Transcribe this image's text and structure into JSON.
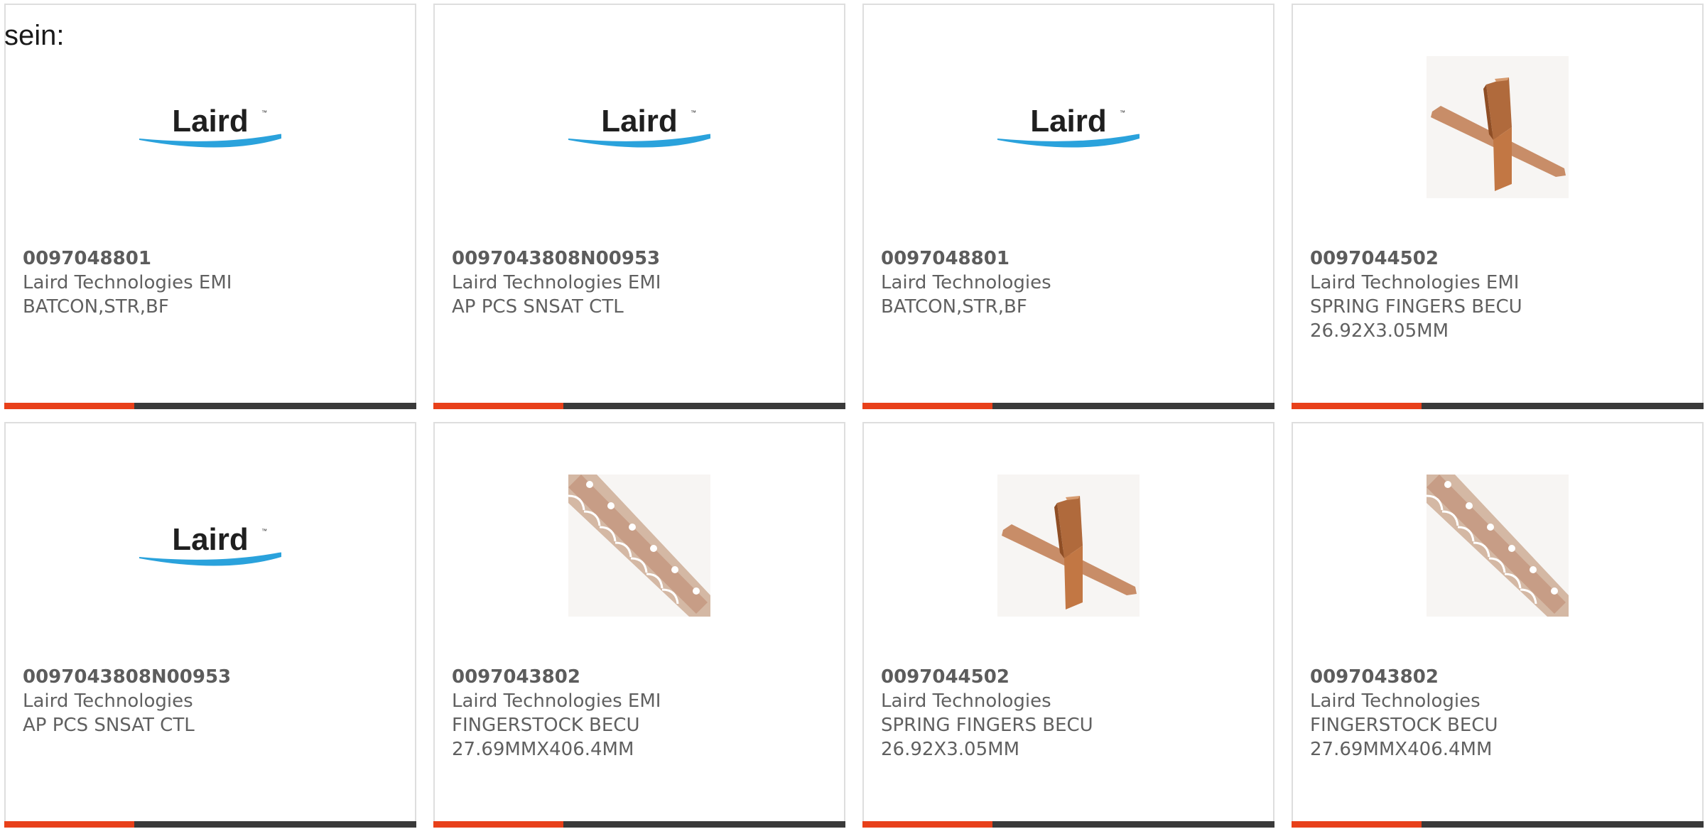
{
  "intro_text": "sein:",
  "colors": {
    "accent": "#e8401a",
    "bar_dark": "#3a3a3a",
    "text": "#606060",
    "border": "#dedede"
  },
  "products": [
    {
      "part_number": "0097048801",
      "manufacturer": "Laird Technologies EMI",
      "desc1": "BATCON,STR,BF",
      "desc2": "",
      "image": "laird-logo"
    },
    {
      "part_number": "0097043808N00953",
      "manufacturer": "Laird Technologies EMI",
      "desc1": "AP PCS SNSAT CTL",
      "desc2": "",
      "image": "laird-logo"
    },
    {
      "part_number": "0097048801",
      "manufacturer": "Laird Technologies",
      "desc1": "BATCON,STR,BF",
      "desc2": "",
      "image": "laird-logo"
    },
    {
      "part_number": "0097044502",
      "manufacturer": "Laird Technologies EMI",
      "desc1": "SPRING FINGERS BECU",
      "desc2": "26.92X3.05MM",
      "image": "spring-finger"
    },
    {
      "part_number": "0097043808N00953",
      "manufacturer": "Laird Technologies",
      "desc1": "AP PCS SNSAT CTL",
      "desc2": "",
      "image": "laird-logo"
    },
    {
      "part_number": "0097043802",
      "manufacturer": "Laird Technologies EMI",
      "desc1": "FINGERSTOCK BECU",
      "desc2": "27.69MMX406.4MM",
      "image": "fingerstock"
    },
    {
      "part_number": "0097044502",
      "manufacturer": "Laird Technologies",
      "desc1": "SPRING FINGERS BECU",
      "desc2": "26.92X3.05MM",
      "image": "spring-finger"
    },
    {
      "part_number": "0097043802",
      "manufacturer": "Laird Technologies",
      "desc1": "FINGERSTOCK BECU",
      "desc2": "27.69MMX406.4MM",
      "image": "fingerstock"
    }
  ],
  "logo_text": "Laird"
}
